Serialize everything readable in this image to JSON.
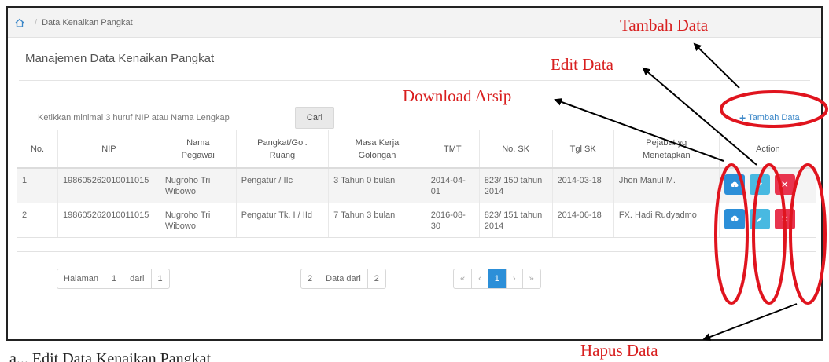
{
  "breadcrumb": {
    "separator": "/",
    "current": "Data Kenaikan Pangkat"
  },
  "page": {
    "title": "Manajemen Data Kenaikan Pangkat"
  },
  "search": {
    "placeholder": "Ketikkan minimal 3 huruf NIP atau Nama Lengkap",
    "button_label": "Cari"
  },
  "add_button": {
    "label": "Tambah Data",
    "icon": "plus-icon"
  },
  "table": {
    "headers": {
      "no": "No.",
      "nip": "NIP",
      "nama": "Nama Pegawai",
      "pangkat": "Pangkat/Gol. Ruang",
      "masa_kerja": "Masa Kerja Golongan",
      "tmt": "TMT",
      "no_sk": "No. SK",
      "tgl_sk": "Tgl SK",
      "pejabat": "Pejabat yg Menetapkan",
      "action": "Action"
    },
    "rows": [
      {
        "no": "1",
        "nip": "198605262010011015",
        "nama": "Nugroho Tri Wibowo",
        "pangkat": "Pengatur / IIc",
        "masa_kerja": "3 Tahun 0 bulan",
        "tmt": "2014-04-01",
        "no_sk": "823/ 150 tahun 2014",
        "tgl_sk": "2014-03-18",
        "pejabat": "Jhon Manul M."
      },
      {
        "no": "2",
        "nip": "198605262010011015",
        "nama": "Nugroho Tri Wibowo",
        "pangkat": "Pengatur Tk. I / IId",
        "masa_kerja": "7 Tahun 3 bulan",
        "tmt": "2016-08-30",
        "no_sk": "823/ 151 tahun 2014",
        "tgl_sk": "2014-06-18",
        "pejabat": "FX. Hadi Rudyadmo"
      }
    ],
    "action_icons": {
      "download": "cloud-download-icon",
      "edit": "pencil-icon",
      "delete": "close-icon"
    }
  },
  "pagination": {
    "page_label": "Halaman",
    "page_current": "1",
    "of_label": "dari",
    "page_total": "1",
    "records_shown": "2",
    "records_label": "Data dari",
    "records_total": "2",
    "nav": {
      "first": "«",
      "prev": "‹",
      "current": "1",
      "next": "›",
      "last": "»"
    }
  },
  "annotations": {
    "tambah": "Tambah Data",
    "edit": "Edit Data",
    "download": "Download Arsip",
    "hapus": "Hapus Data",
    "color": "#d81e1e"
  },
  "caption_fragment": "a... Edit Data Kenaikan Pangkat"
}
